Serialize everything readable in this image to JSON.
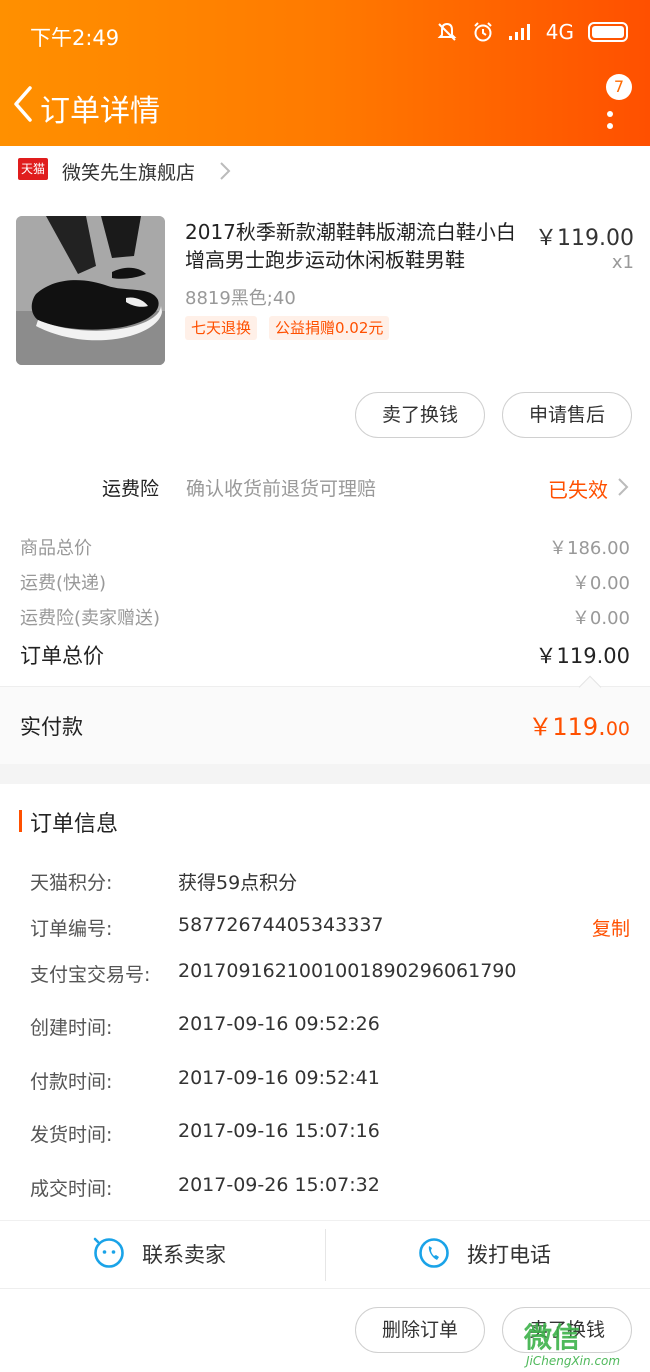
{
  "status_bar": {
    "time": "下午2:49",
    "network": "4G"
  },
  "nav": {
    "title": "订单详情",
    "badge_count": "7"
  },
  "shop": {
    "badge": "天猫",
    "name": "微笑先生旗舰店"
  },
  "product": {
    "title": "2017秋季新款潮鞋韩版潮流白鞋小白增高男士跑步运动休闲板鞋男鞋",
    "price": "￥119.00",
    "quantity": "x1",
    "spec": "8819黑色;40",
    "tags": [
      "七天退换",
      "公益捐赠0.02元"
    ],
    "actions": [
      "卖了换钱",
      "申请售后"
    ]
  },
  "insurance": {
    "label": "运费险",
    "description": "确认收货前退货可理赔",
    "status": "已失效"
  },
  "prices": [
    {
      "label": "商品总价",
      "value": "￥186.00"
    },
    {
      "label": "运费(快递)",
      "value": "￥0.00"
    },
    {
      "label": "运费险(卖家赠送)",
      "value": "￥0.00"
    }
  ],
  "order_total": {
    "label": "订单总价",
    "value": "￥119.00"
  },
  "paid": {
    "label": "实付款",
    "value_main": "￥119.",
    "value_cents": "00"
  },
  "order_info": {
    "title": "订单信息",
    "rows": [
      {
        "label": "天猫积分:",
        "value": "获得59点积分"
      },
      {
        "label": "订单编号:",
        "value": "58772674405343337"
      },
      {
        "label": "支付宝交易号:",
        "value": "2017091621001001890296061790"
      },
      {
        "label": "创建时间:",
        "value": "2017-09-16 09:52:26"
      },
      {
        "label": "付款时间:",
        "value": "2017-09-16 09:52:41"
      },
      {
        "label": "发货时间:",
        "value": "2017-09-16 15:07:16"
      },
      {
        "label": "成交时间:",
        "value": "2017-09-26 15:07:32"
      }
    ],
    "copy_label": "复制"
  },
  "contact": {
    "seller_label": "联系卖家",
    "phone_label": "拨打电话"
  },
  "footer": {
    "actions": [
      "删除订单",
      "卖了换钱"
    ]
  },
  "watermark": {
    "text": "微信",
    "sub": "JiChengXin.com"
  },
  "colors": {
    "accent": "#ff5000",
    "header_start": "#ff9000",
    "header_end": "#ff5000",
    "contact_icon": "#1aa3e8"
  }
}
